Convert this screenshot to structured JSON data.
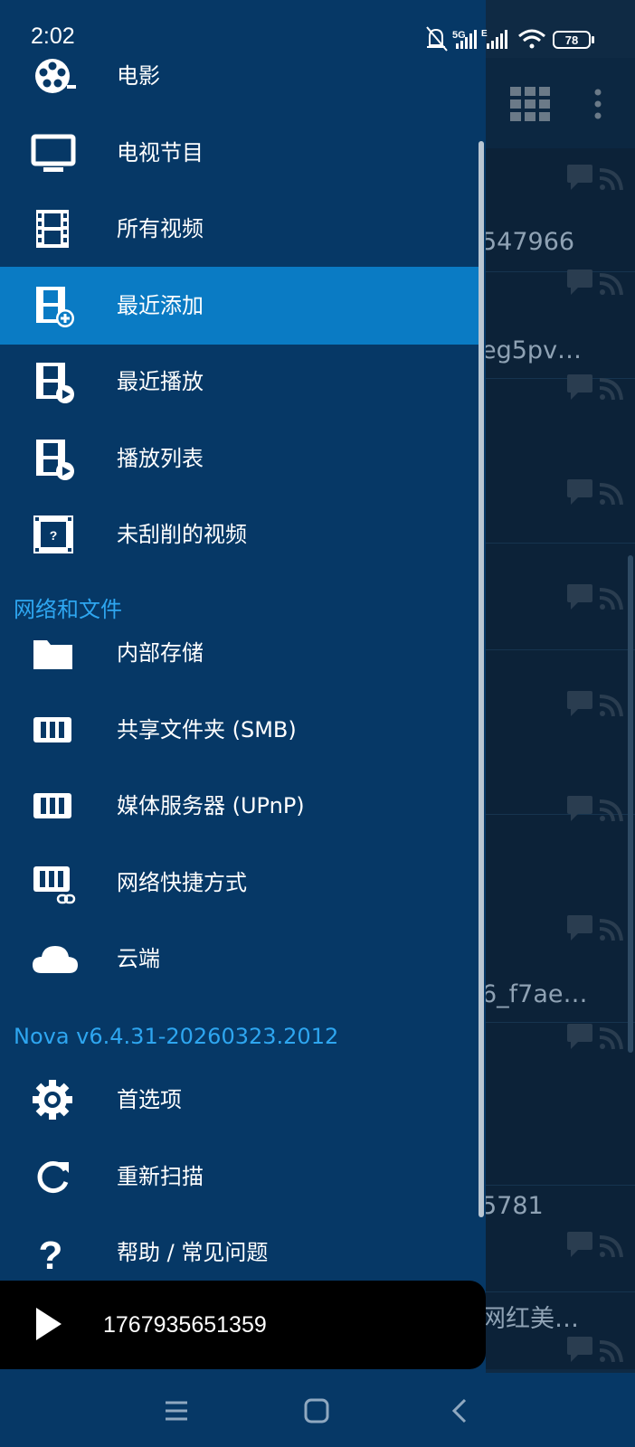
{
  "status_bar": {
    "time": "2:02",
    "battery": "78",
    "network1": "5G",
    "network2": "E"
  },
  "drawer": {
    "items_top": [
      {
        "label": "电影",
        "icon": "movie-reel-icon"
      },
      {
        "label": "电视节目",
        "icon": "tv-icon"
      },
      {
        "label": "所有视频",
        "icon": "film-strip-icon"
      },
      {
        "label": "最近添加",
        "icon": "film-add-icon",
        "active": true
      },
      {
        "label": "最近播放",
        "icon": "film-play-icon"
      },
      {
        "label": "播放列表",
        "icon": "film-play-icon"
      },
      {
        "label": "未刮削的视频",
        "icon": "film-unknown-icon"
      }
    ],
    "section_network": "网络和文件",
    "items_network": [
      {
        "label": "内部存储",
        "icon": "folder-icon"
      },
      {
        "label": "共享文件夹 (SMB)",
        "icon": "nas-icon"
      },
      {
        "label": "媒体服务器 (UPnP)",
        "icon": "nas-icon"
      },
      {
        "label": "网络快捷方式",
        "icon": "nas-link-icon"
      },
      {
        "label": "云端",
        "icon": "cloud-icon"
      }
    ],
    "version": "Nova v6.4.31-20260323.2012",
    "items_bottom": [
      {
        "label": "首选项",
        "icon": "gear-icon"
      },
      {
        "label": "重新扫描",
        "icon": "refresh-icon"
      },
      {
        "label": "帮助 / 常见问题",
        "icon": "help-icon"
      }
    ]
  },
  "background_list": [
    "547966",
    "eg5pv…",
    "6_f7ae…",
    "5781",
    "网红美…"
  ],
  "player": {
    "title": "1767935651359"
  },
  "colors": {
    "drawer_bg": "#063866",
    "active_bg": "#0a7bc4",
    "section": "#2ea6f0"
  }
}
